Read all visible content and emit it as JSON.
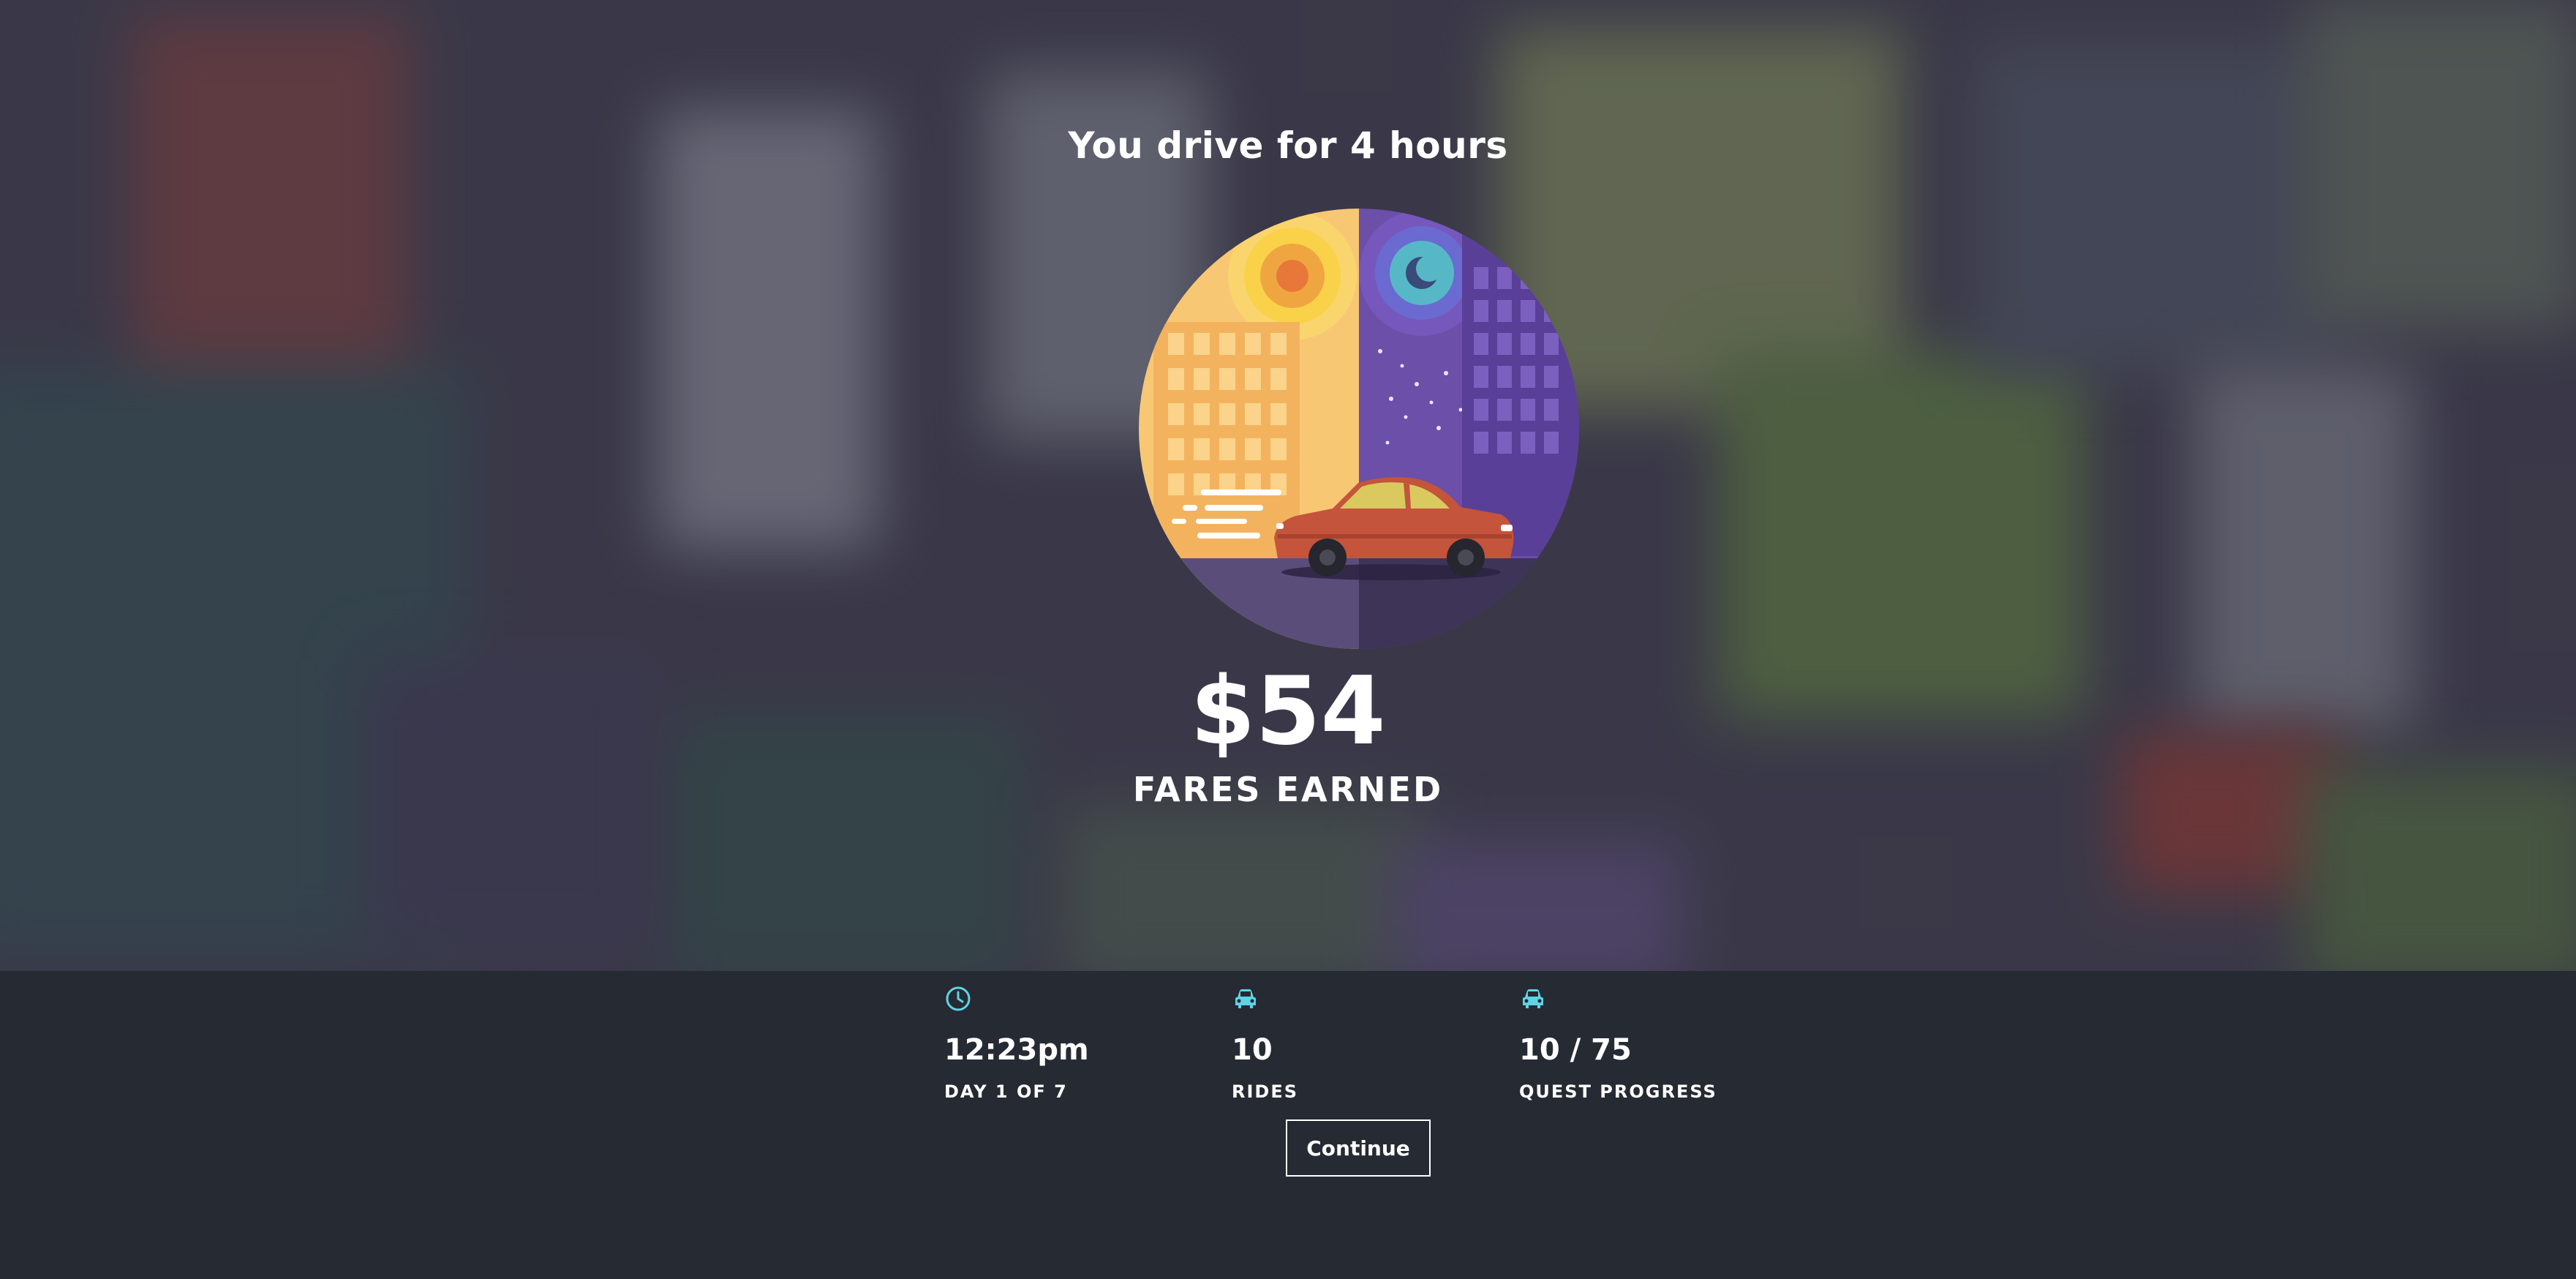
{
  "screen": {
    "headline": "You drive for 4 hours",
    "illustration": "day-night-driving-car",
    "earnings": {
      "amount": "$54",
      "label": "FARES EARNED"
    }
  },
  "stats": [
    {
      "icon": "clock-icon",
      "value": "12:23pm",
      "label": "DAY 1 OF 7"
    },
    {
      "icon": "car-icon",
      "value": "10",
      "label": "RIDES"
    },
    {
      "icon": "car-icon",
      "value": "10 / 75",
      "label": "QUEST PROGRESS"
    }
  ],
  "continue_label": "Continue",
  "colors": {
    "accent": "#5fd3e6",
    "bar_background": "#262a33",
    "day_sky": "#f8c774",
    "night_sky": "#6b4fa8",
    "car": "#c4543b"
  }
}
